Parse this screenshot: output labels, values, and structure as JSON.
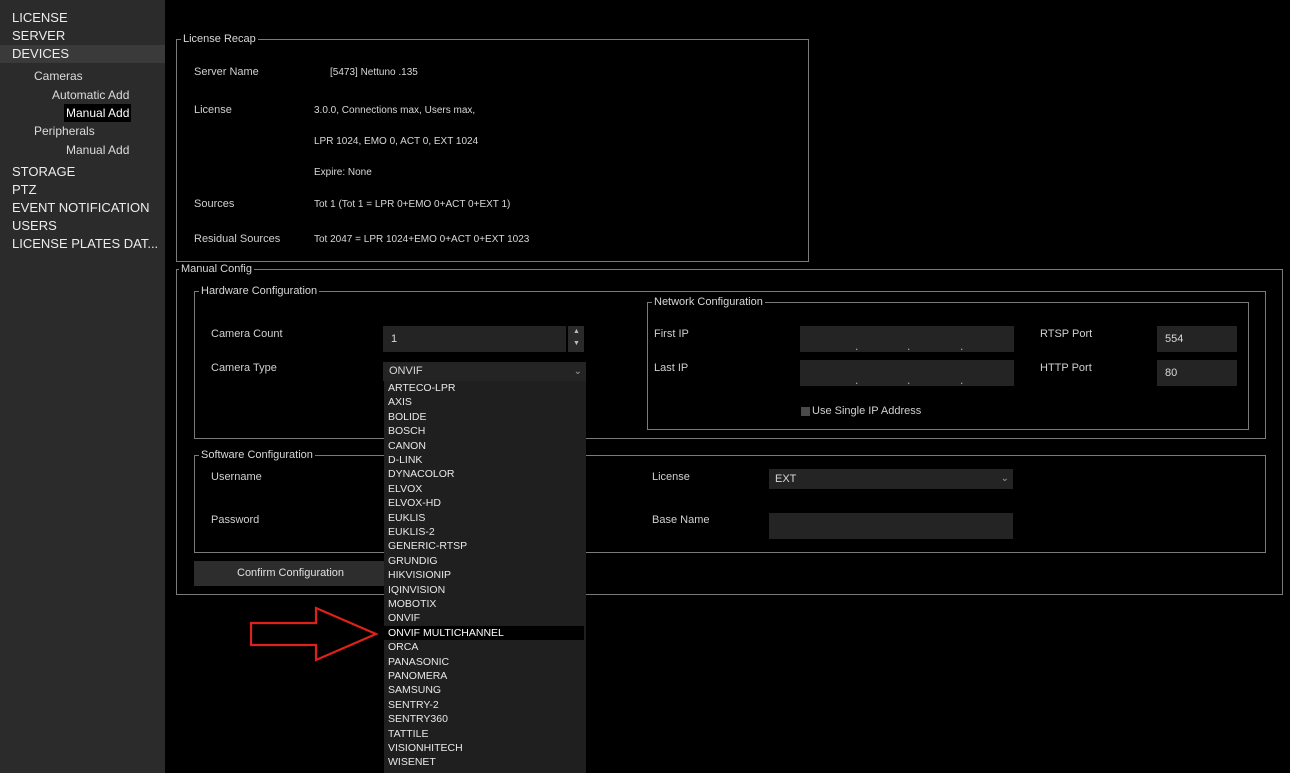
{
  "sidebar": {
    "items": [
      {
        "label": "LICENSE"
      },
      {
        "label": "SERVER"
      },
      {
        "label": "DEVICES"
      },
      {
        "label": "Cameras"
      },
      {
        "label": "Automatic Add"
      },
      {
        "label": "Manual Add"
      },
      {
        "label": "Peripherals"
      },
      {
        "label": "Manual Add"
      },
      {
        "label": "STORAGE"
      },
      {
        "label": "PTZ"
      },
      {
        "label": "EVENT NOTIFICATION"
      },
      {
        "label": "USERS"
      },
      {
        "label": "LICENSE PLATES DAT..."
      }
    ]
  },
  "license_recap": {
    "title": "License Recap",
    "server_name_label": "Server Name",
    "server_name_value": "[5473] Nettuno .135",
    "license_label": "License",
    "license_line1": "3.0.0, Connections max, Users max,",
    "license_line2": "LPR 1024, EMO 0, ACT 0, EXT 1024",
    "license_line3": "Expire: None",
    "sources_label": "Sources",
    "sources_value": "Tot 1 (Tot 1 = LPR 0+EMO 0+ACT 0+EXT 1)",
    "residual_label": "Residual Sources",
    "residual_value": "Tot 2047 = LPR 1024+EMO 0+ACT 0+EXT 1023"
  },
  "manual_config": {
    "title": "Manual Config",
    "hardware": {
      "title": "Hardware Configuration",
      "camera_count_label": "Camera Count",
      "camera_count_value": "1",
      "camera_type_label": "Camera Type",
      "camera_type_value": "ONVIF"
    },
    "network": {
      "title": "Network Configuration",
      "first_ip_label": "First IP",
      "last_ip_label": "Last IP",
      "rtsp_port_label": "RTSP Port",
      "rtsp_port_value": "554",
      "http_port_label": "HTTP Port",
      "http_port_value": "80",
      "use_single_ip_label": "Use Single IP Address"
    },
    "software": {
      "title": "Software Configuration",
      "username_label": "Username",
      "password_label": "Password",
      "license_label": "License",
      "license_value": "EXT",
      "base_name_label": "Base Name"
    },
    "confirm_button": "Confirm Configuration"
  },
  "camera_type_options": [
    "ARTECO-LPR",
    "AXIS",
    "BOLIDE",
    "BOSCH",
    "CANON",
    "D-LINK",
    "DYNACOLOR",
    "ELVOX",
    "ELVOX-HD",
    "EUKLIS",
    "EUKLIS-2",
    "GENERIC-RTSP",
    "GRUNDIG",
    "HIKVISIONIP",
    "IQINVISION",
    "MOBOTIX",
    "ONVIF",
    "ONVIF MULTICHANNEL",
    "ORCA",
    "PANASONIC",
    "PANOMERA",
    "SAMSUNG",
    "SENTRY-2",
    "SENTRY360",
    "TATTILE",
    "VISIONHITECH",
    "WISENET"
  ],
  "highlighted_option": "ONVIF MULTICHANNEL",
  "colors": {
    "arrow": "#e0201b",
    "sidebar_bg": "#2b2b2b",
    "field_bg": "#242424"
  }
}
